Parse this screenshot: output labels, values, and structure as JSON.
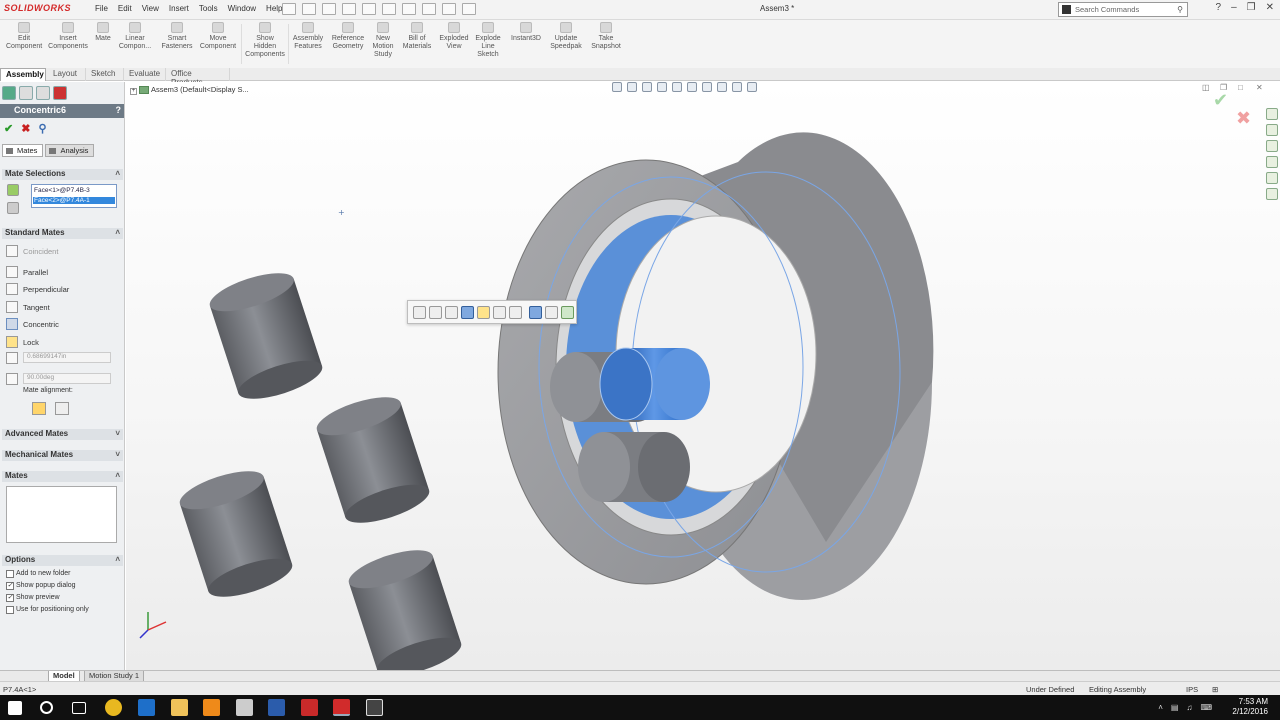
{
  "app": {
    "logo_text": "SOLIDWORKS",
    "document_title": "Assem3 *",
    "menu": [
      "File",
      "Edit",
      "View",
      "Insert",
      "Tools",
      "Window",
      "Help"
    ],
    "search_placeholder": "Search Commands"
  },
  "command_manager": {
    "buttons": [
      {
        "label": "Edit\nComponent"
      },
      {
        "label": "Insert\nComponents"
      },
      {
        "label": "Mate"
      },
      {
        "label": "Linear\nCompon..."
      },
      {
        "label": "Smart\nFasteners"
      },
      {
        "label": "Move\nComponent"
      },
      {
        "label": "Show\nHidden\nComponents"
      },
      {
        "label": "Assembly\nFeatures"
      },
      {
        "label": "Reference\nGeometry"
      },
      {
        "label": "New\nMotion\nStudy"
      },
      {
        "label": "Bill of\nMaterials"
      },
      {
        "label": "Exploded\nView"
      },
      {
        "label": "Explode\nLine\nSketch"
      },
      {
        "label": "Instant3D"
      },
      {
        "label": "Update\nSpeedpak"
      },
      {
        "label": "Take\nSnapshot"
      }
    ],
    "tabs": [
      "Assembly",
      "Layout",
      "Sketch",
      "Evaluate",
      "Office Products"
    ],
    "active_tab": "Assembly"
  },
  "property_manager": {
    "title": "Concentric6",
    "help": "?",
    "subtabs": [
      "Mates",
      "Analysis"
    ],
    "sections": {
      "mate_selections": "Mate Selections",
      "standard_mates": "Standard Mates",
      "advanced_mates": "Advanced Mates",
      "mechanical_mates": "Mechanical Mates",
      "mates": "Mates",
      "options": "Options"
    },
    "selections": [
      "Face<1>@P7.4B-3",
      "Face<2>@P7.4A-1"
    ],
    "standard_mates": [
      {
        "label": "Coincident",
        "dim": true
      },
      {
        "label": "Parallel"
      },
      {
        "label": "Perpendicular"
      },
      {
        "label": "Tangent"
      },
      {
        "label": "Concentric",
        "selected": true
      },
      {
        "label": "Lock"
      }
    ],
    "distance_value": "0.68699147in",
    "angle_value": "90.00deg",
    "mate_alignment_label": "Mate alignment:",
    "options": [
      {
        "label": "Add to new folder",
        "checked": false
      },
      {
        "label": "Show popup dialog",
        "checked": true
      },
      {
        "label": "Show preview",
        "checked": true
      },
      {
        "label": "Use for positioning only",
        "checked": false
      }
    ]
  },
  "graphics": {
    "tree_label": "Assem3  (Default<Display S..."
  },
  "bottom": {
    "model_tabs": [
      "Model",
      "Motion Study 1"
    ],
    "status_left": "P7.4A<1>",
    "status_state": "Under Defined",
    "status_mode": "Editing Assembly",
    "status_units": "IPS",
    "time": "7:53 AM",
    "date": "2/12/2016"
  }
}
